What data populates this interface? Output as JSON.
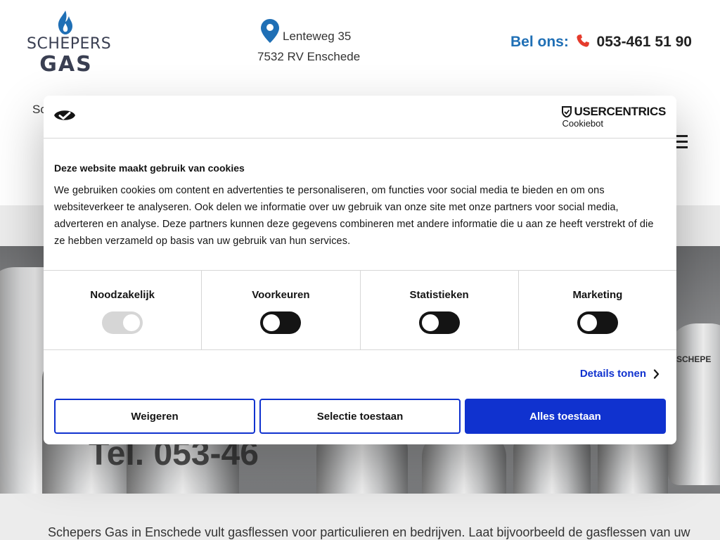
{
  "header": {
    "logo": {
      "top": "SCHEPERS",
      "bottom": "GAS"
    },
    "address": {
      "line1": "Lenteweg 35",
      "line2": "7532 RV Enschede"
    },
    "phone": {
      "label": "Bel ons:",
      "number": "053-461 51 90"
    },
    "nav_peek": "Sc"
  },
  "hero": {
    "tel_text": "Tel. 053-46",
    "tag": "SCHEPE"
  },
  "intro": {
    "text": "Schepers Gas in Enschede vult gasflessen voor particulieren en bedrijven. Laat bijvoorbeeld de gasflessen van uw"
  },
  "cookie": {
    "brand": {
      "name": "USERCENTRICS",
      "product": "Cookiebot"
    },
    "title": "Deze website maakt gebruik van cookies",
    "body": "We gebruiken cookies om content en advertenties te personaliseren, om functies voor social media te bieden en om ons websiteverkeer te analyseren. Ook delen we informatie over uw gebruik van onze site met onze partners voor social media, adverteren en analyse. Deze partners kunnen deze gegevens combineren met andere informatie die u aan ze heeft verstrekt of die ze hebben verzameld op basis van uw gebruik van hun services.",
    "categories": [
      {
        "label": "Noodzakelijk",
        "enabled": true,
        "locked": true
      },
      {
        "label": "Voorkeuren",
        "enabled": false,
        "locked": false
      },
      {
        "label": "Statistieken",
        "enabled": false,
        "locked": false
      },
      {
        "label": "Marketing",
        "enabled": false,
        "locked": false
      }
    ],
    "details_link": "Details tonen",
    "buttons": {
      "reject": "Weigeren",
      "selection": "Selectie toestaan",
      "accept_all": "Alles toestaan"
    }
  },
  "colors": {
    "brand_blue": "#1f6fb5",
    "cookie_blue": "#1032cf",
    "phone_red": "#e53b2c",
    "text_dark": "#141414"
  },
  "icons": [
    "flame-icon",
    "location-pin-icon",
    "phone-icon",
    "hamburger-menu-icon",
    "cookiebot-eye-icon",
    "usercentrics-shield-icon",
    "chevron-right-icon"
  ]
}
